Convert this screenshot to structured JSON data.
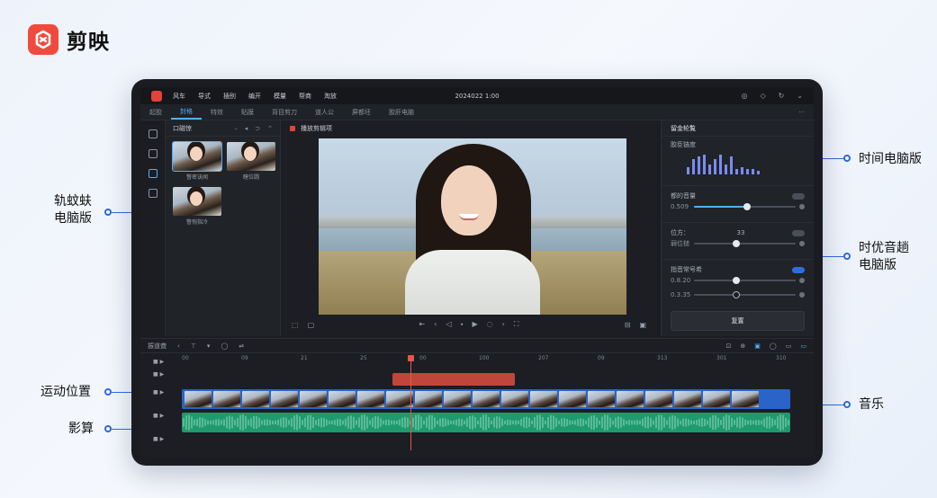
{
  "brand": {
    "name": "剪映",
    "color": "#f04a3e",
    "icon": "jianying-logo-icon"
  },
  "callouts": {
    "left_top": "轨蚊蚨\n电脑版",
    "left_top_lines": [
      "轨蚊蚨",
      "电脑版"
    ],
    "left_mid": "运动位置",
    "left_bottom": "影算",
    "right_top": "时间电脑版",
    "right_mid_lines": [
      "时优音趟",
      "电脑版"
    ],
    "right_bottom": "音乐"
  },
  "app": {
    "menu": [
      "风车",
      "导式",
      "插别",
      "编开",
      "模量",
      "帮商",
      "淘放"
    ],
    "project_title": "2024022 1:00",
    "window_controls": [
      "help-icon",
      "user-icon",
      "refresh-icon",
      "chevron-down-icon"
    ],
    "tabs": [
      "起胶",
      "封格",
      "特效",
      "贴膜",
      "背目剪刀",
      "道人公",
      "屏都坯",
      "胶肝电脑"
    ],
    "active_tab": 1,
    "left_rail_icons": [
      "media-icon",
      "tag-icon",
      "sticker-icon",
      "text-icon"
    ],
    "media": {
      "title": "口磁惊",
      "controls": [
        "minus-icon",
        "grid-icon",
        "sort-icon",
        "more-icon"
      ],
      "items": [
        {
          "label": "瞥密诀闻",
          "selected": true
        },
        {
          "label": "瞎位闘",
          "selected": false
        },
        {
          "label": "瞥惋指冷",
          "selected": false
        }
      ]
    },
    "viewer": {
      "title": "播放剪辑项",
      "left_controls": [
        "crop-icon",
        "fit-icon"
      ],
      "center_controls": [
        "skip-back-icon",
        "prev-icon",
        "rewind-icon",
        "marker-icon",
        "play-icon",
        "loop-icon",
        "next-icon",
        "fullscreen-icon"
      ],
      "right_controls": [
        "ratio-icon",
        "settings-icon"
      ]
    },
    "props": {
      "title": "留金轮覧",
      "section1_label": "胶臣链度",
      "bars": [
        6,
        12,
        14,
        16,
        8,
        12,
        16,
        8,
        14,
        4,
        6,
        4,
        4,
        3
      ],
      "sec2_label": "都的音量",
      "sec2_value": "0.509",
      "sec2_level": 0.52,
      "sec3_label": "位方：",
      "sec3_badge": "33",
      "sec3_row2_label": "弱位槌",
      "sec3_level": 0.42,
      "sec4_label": "指音常号希",
      "sec4_val1": "0.8.20",
      "sec4_level1": 0.42,
      "sec4_val2": "0.3.35",
      "sec4_level2": 0.42,
      "save_label": "复置"
    },
    "timeline": {
      "left_label": "振道聋",
      "tools": [
        "undo-icon",
        "split-icon",
        "delete-icon",
        "freeze-icon",
        "ratio-icon"
      ],
      "right_tools": [
        "zoom-icon",
        "magnet-icon",
        "link-icon",
        "preview-icon",
        "audio-icon",
        "fit-icon"
      ],
      "ruler": [
        "00",
        "09",
        "21",
        "25",
        "00",
        "100",
        "207",
        "09",
        "313",
        "301",
        "310"
      ],
      "playhead_pos": 0.376
    }
  }
}
